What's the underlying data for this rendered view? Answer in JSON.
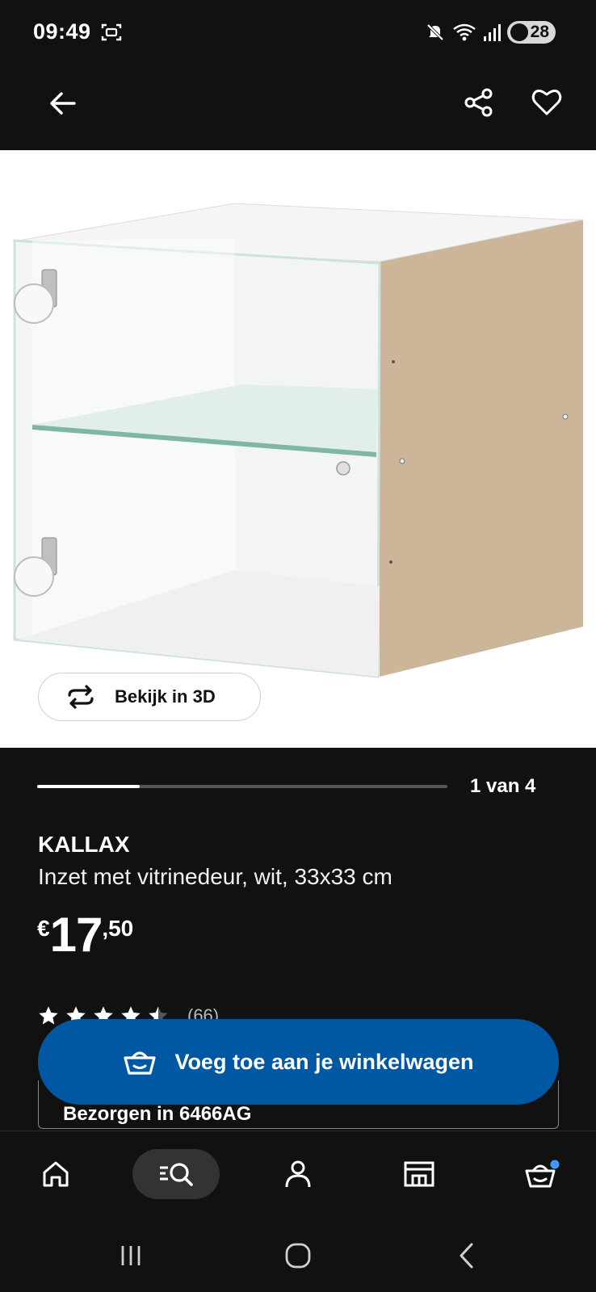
{
  "status_bar": {
    "time": "09:49",
    "battery": "28",
    "icons": [
      "screenshot-icon",
      "mute-icon",
      "wifi-icon",
      "signal-icon",
      "battery-saver-icon"
    ]
  },
  "header": {
    "back_icon": "arrow-left-icon",
    "share_icon": "share-icon",
    "favorite_icon": "heart-icon"
  },
  "gallery": {
    "view_3d_label": "Bekijk in 3D",
    "position_label": "1 van 4",
    "progress_fraction": 0.25
  },
  "product": {
    "name": "KALLAX",
    "description": "Inzet met vitrinedeur, wit, 33x33 cm",
    "price_currency": "€",
    "price_integer": "17",
    "price_decimal": ",50",
    "rating_stars": 4.5,
    "rating_count": "(66)"
  },
  "cart_button": {
    "label": "Voeg toe aan je winkelwagen",
    "icon": "basket-icon"
  },
  "delivery": {
    "label": "Bezorgen in 6466AG"
  },
  "bottom_nav": {
    "items": [
      "home-icon",
      "search-icon",
      "profile-icon",
      "store-icon",
      "cart-icon"
    ],
    "active": "search",
    "cart_badge_color": "#3b9cff"
  },
  "colors": {
    "accent": "#0058a3",
    "background": "#111111"
  }
}
